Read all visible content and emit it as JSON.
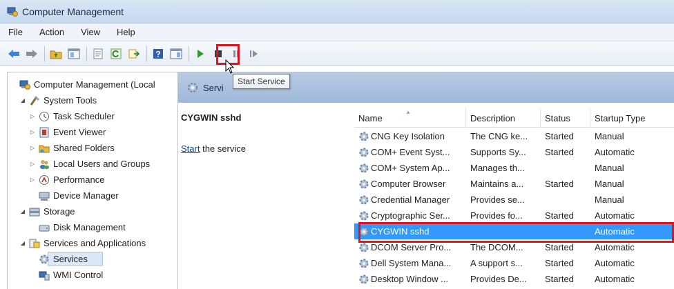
{
  "window": {
    "title": "Computer Management"
  },
  "menu": [
    "File",
    "Action",
    "View",
    "Help"
  ],
  "toolbar": {
    "icons": [
      "back-icon",
      "forward-icon",
      "up-folder-icon",
      "show-hide-tree-icon",
      "properties-icon",
      "refresh-icon",
      "export-list-icon",
      "help-icon",
      "show-hide-action-pane-icon",
      "start-service-icon",
      "stop-service-icon",
      "pause-service-icon",
      "restart-service-icon"
    ],
    "tooltip": "Start Service"
  },
  "tree": [
    {
      "label": "Computer Management (Local",
      "level": 0,
      "arrow": "",
      "icon": "computer-management-icon"
    },
    {
      "label": "System Tools",
      "level": 1,
      "arrow": "◢",
      "icon": "system-tools-icon"
    },
    {
      "label": "Task Scheduler",
      "level": 2,
      "arrow": "▷",
      "icon": "clock-icon"
    },
    {
      "label": "Event Viewer",
      "level": 2,
      "arrow": "▷",
      "icon": "event-viewer-icon"
    },
    {
      "label": "Shared Folders",
      "level": 2,
      "arrow": "▷",
      "icon": "shared-folders-icon"
    },
    {
      "label": "Local Users and Groups",
      "level": 2,
      "arrow": "▷",
      "icon": "users-icon"
    },
    {
      "label": "Performance",
      "level": 2,
      "arrow": "▷",
      "icon": "performance-icon"
    },
    {
      "label": "Device Manager",
      "level": 2,
      "arrow": "",
      "icon": "device-manager-icon"
    },
    {
      "label": "Storage",
      "level": 1,
      "arrow": "◢",
      "icon": "storage-icon"
    },
    {
      "label": "Disk Management",
      "level": 2,
      "arrow": "",
      "icon": "disk-icon"
    },
    {
      "label": "Services and Applications",
      "level": 1,
      "arrow": "◢",
      "icon": "services-apps-icon"
    },
    {
      "label": "Services",
      "level": 2,
      "arrow": "",
      "icon": "services-icon",
      "selected": true
    },
    {
      "label": "WMI Control",
      "level": 2,
      "arrow": "",
      "icon": "wmi-icon"
    }
  ],
  "panel": {
    "header": "Servi",
    "selected_service": "CYGWIN sshd",
    "start_link": "Start",
    "start_suffix": " the service"
  },
  "columns": {
    "name": "Name",
    "description": "Description",
    "status": "Status",
    "startup": "Startup Type"
  },
  "services": [
    {
      "name": "CNG Key Isolation",
      "description": "The CNG ke...",
      "status": "Started",
      "startup": "Manual"
    },
    {
      "name": "COM+ Event Syst...",
      "description": "Supports Sy...",
      "status": "Started",
      "startup": "Automatic"
    },
    {
      "name": "COM+ System Ap...",
      "description": "Manages th...",
      "status": "",
      "startup": "Manual"
    },
    {
      "name": "Computer Browser",
      "description": "Maintains a...",
      "status": "Started",
      "startup": "Manual"
    },
    {
      "name": "Credential Manager",
      "description": "Provides se...",
      "status": "",
      "startup": "Manual"
    },
    {
      "name": "Cryptographic Ser...",
      "description": "Provides fo...",
      "status": "Started",
      "startup": "Automatic"
    },
    {
      "name": "CYGWIN sshd",
      "description": "",
      "status": "",
      "startup": "Automatic",
      "selected": true
    },
    {
      "name": "DCOM Server Pro...",
      "description": "The DCOM...",
      "status": "Started",
      "startup": "Automatic"
    },
    {
      "name": "Dell System Mana...",
      "description": "A support s...",
      "status": "Started",
      "startup": "Automatic"
    },
    {
      "name": "Desktop Window ...",
      "description": "Provides De...",
      "status": "Started",
      "startup": "Automatic"
    }
  ],
  "colors": {
    "highlight": "#e0141e",
    "selection": "#3399ff"
  }
}
